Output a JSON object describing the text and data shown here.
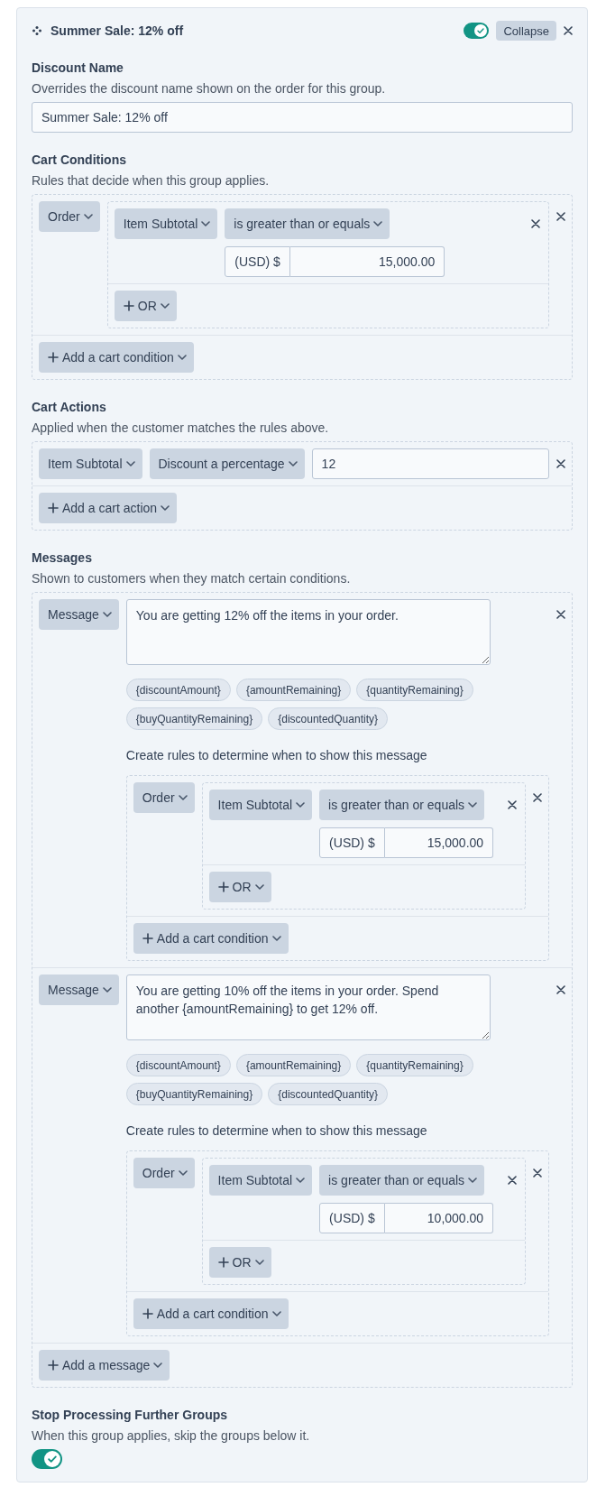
{
  "header": {
    "title": "Summer Sale: 12% off",
    "enabled": true,
    "collapse_button": "Collapse"
  },
  "discount_name": {
    "label": "Discount Name",
    "description": "Overrides the discount name shown on the order for this group.",
    "value": "Summer Sale: 12% off"
  },
  "cart_conditions": {
    "label": "Cart Conditions",
    "description": "Rules that decide when this group applies.",
    "groups": [
      {
        "scope": "Order",
        "conditions": [
          {
            "field": "Item Subtotal",
            "operator": "is greater than or equals",
            "prefix": "(USD) $",
            "value": "15,000.00"
          }
        ],
        "or_button": "OR"
      }
    ],
    "add_button": "Add a cart condition"
  },
  "cart_actions": {
    "label": "Cart Actions",
    "description": "Applied when the customer matches the rules above.",
    "actions": [
      {
        "target": "Item Subtotal",
        "type": "Discount a percentage",
        "value": "12"
      }
    ],
    "add_button": "Add a cart action"
  },
  "messages": {
    "label": "Messages",
    "description": "Shown to customers when they match certain conditions.",
    "items": [
      {
        "message_type": "Message",
        "text": "You are getting 12% off the items in your order.",
        "tokens": [
          "{discountAmount}",
          "{amountRemaining}",
          "{quantityRemaining}",
          "{buyQuantityRemaining}",
          "{discountedQuantity}"
        ],
        "rules_hint": "Create rules to determine when to show this message",
        "rules": {
          "groups": [
            {
              "scope": "Order",
              "conditions": [
                {
                  "field": "Item Subtotal",
                  "operator": "is greater than or equals",
                  "prefix": "(USD) $",
                  "value": "15,000.00"
                }
              ],
              "or_button": "OR"
            }
          ],
          "add_button": "Add a cart condition"
        }
      },
      {
        "message_type": "Message",
        "text": "You are getting 10% off the items in your order. Spend another {amountRemaining} to get 12% off.",
        "tokens": [
          "{discountAmount}",
          "{amountRemaining}",
          "{quantityRemaining}",
          "{buyQuantityRemaining}",
          "{discountedQuantity}"
        ],
        "rules_hint": "Create rules to determine when to show this message",
        "rules": {
          "groups": [
            {
              "scope": "Order",
              "conditions": [
                {
                  "field": "Item Subtotal",
                  "operator": "is greater than or equals",
                  "prefix": "(USD) $",
                  "value": "10,000.00"
                }
              ],
              "or_button": "OR"
            }
          ],
          "add_button": "Add a cart condition"
        }
      }
    ],
    "add_button": "Add a message"
  },
  "stop_processing": {
    "label": "Stop Processing Further Groups",
    "description": "When this group applies, skip the groups below it.",
    "on": true
  }
}
